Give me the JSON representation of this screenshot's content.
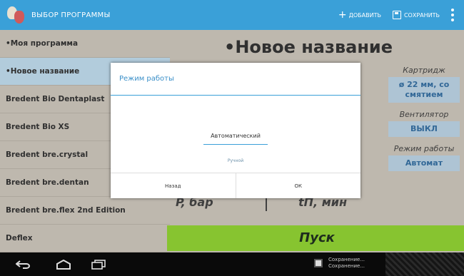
{
  "app": {
    "title": "ВЫБОР ПРОГРАММЫ",
    "brand_color": "#3aa0d8",
    "icon": "app-logo-icon"
  },
  "actions": {
    "add_label": "ДОБАВИТЬ",
    "add_icon": "plus-icon",
    "save_label": "СОХРАНИТЬ",
    "save_icon": "save-icon",
    "overflow_icon": "overflow-menu-icon"
  },
  "programs": [
    {
      "label": "•Моя программа"
    },
    {
      "label": "•Новое название"
    },
    {
      "label": "Bredent Bio Dentaplast"
    },
    {
      "label": "Bredent Bio XS"
    },
    {
      "label": "Bredent bre.crystal"
    },
    {
      "label": "Bredent bre.dentan"
    },
    {
      "label": "Bredent bre.flex 2nd Edition"
    },
    {
      "label": "Deflex"
    }
  ],
  "main": {
    "program_title": "•Новое название",
    "cartridge_label": "Картридж",
    "cartridge_value": "ø 22 мм, со смятием",
    "fan_label": "Вентилятор",
    "fan_value": "ВЫКЛ",
    "mode_label": "Режим работы",
    "mode_value": "Автомат",
    "pressure_label": "P, бар",
    "time_label": "tП, мин",
    "start_label": "Пуск",
    "start_color": "#8fcf33"
  },
  "dialog": {
    "title": "Режим работы",
    "option_auto": "Автоматический",
    "option_manual": "Ручной",
    "cancel_label": "Назад",
    "ok_label": "ОК"
  },
  "system": {
    "notification_line1": "Сохранение...",
    "notification_line2": "Сохранение..."
  }
}
